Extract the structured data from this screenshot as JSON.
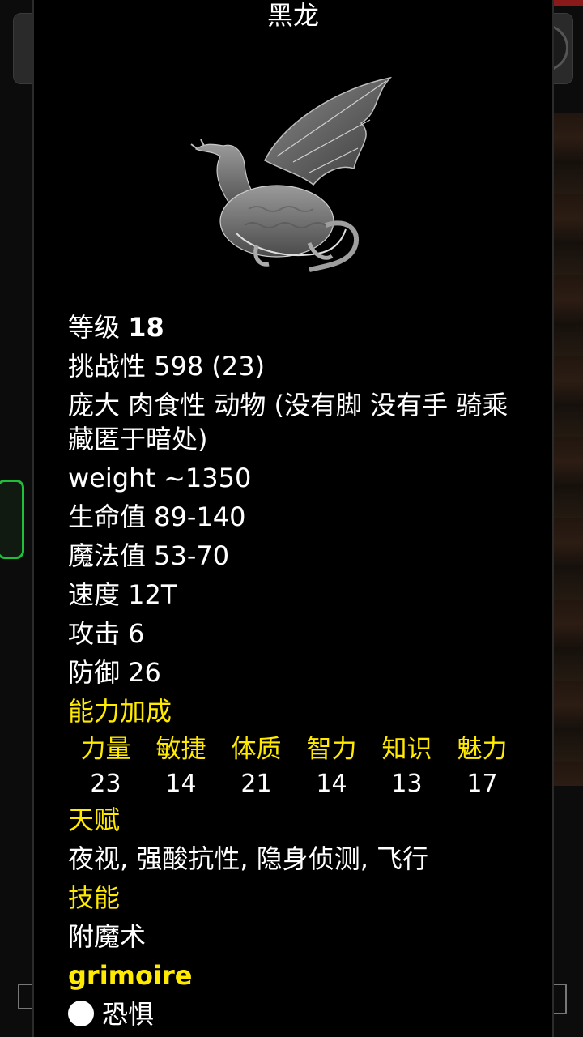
{
  "monster": {
    "name": "黑龙",
    "level_label": "等级",
    "level_value": "18",
    "challenge": "挑战性 598 (23)",
    "traits": "庞大 肉食性 动物 (没有脚 没有手 骑乘 藏匿于暗处)",
    "weight": "weight ~1350",
    "hp": "生命值 89-140",
    "mp": "魔法值 53-70",
    "speed": "速度 12T",
    "attack": "攻击 6",
    "defense": "防御 26"
  },
  "attributes": {
    "header": "能力加成",
    "items": [
      {
        "label": "力量",
        "value": "23"
      },
      {
        "label": "敏捷",
        "value": "14"
      },
      {
        "label": "体质",
        "value": "21"
      },
      {
        "label": "智力",
        "value": "14"
      },
      {
        "label": "知识",
        "value": "13"
      },
      {
        "label": "魅力",
        "value": "17"
      }
    ]
  },
  "talents": {
    "header": "天赋",
    "value": "夜视, 强酸抗性, 隐身侦测, 飞行"
  },
  "skills": {
    "header": "技能",
    "value": "附魔术"
  },
  "grimoire": {
    "header": "grimoire",
    "spells": [
      {
        "label": "恐惧"
      }
    ]
  },
  "colors": {
    "accent": "#ffea00",
    "background": "#000000",
    "text": "#ffffff"
  },
  "icons": {
    "portrait": "black-dragon-image",
    "spell": "white-circle-icon"
  }
}
